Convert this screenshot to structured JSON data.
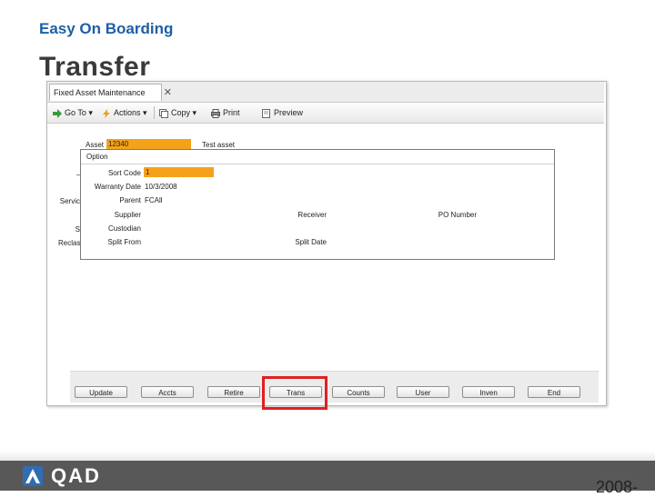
{
  "slide": {
    "subtitle": "Easy On Boarding",
    "title": "Transfer",
    "year": "2008-"
  },
  "window": {
    "tab_label": "Fixed Asset Maintenance",
    "tab_close": "✕"
  },
  "toolbar": {
    "goto": "Go To",
    "actions": "Actions",
    "copy": "Copy",
    "print": "Print",
    "preview": "Preview"
  },
  "form": {
    "asset_label": "Asset",
    "asset_value": "12340",
    "asset_desc": "Test asset",
    "left_labels": [
      "Servic",
      "S",
      "Reclas"
    ],
    "fields": {
      "sort_code_label": "Sort Code",
      "sort_code_value": "1",
      "warranty_label": "Warranty Date",
      "warranty_value": "10/3/2008",
      "parent_label": "Parent",
      "parent_value": "FCAll",
      "supplier_label": "Supplier",
      "receiver_label": "Receiver",
      "po_label": "PO Number",
      "custodian_label": "Custodian",
      "split_from_label": "Split From",
      "split_date_label": "Split Date"
    }
  },
  "dialog": {
    "title": "Option"
  },
  "buttons": [
    "Update",
    "Accts",
    "Retire",
    "Trans",
    "Counts",
    "User",
    "Inven",
    "End"
  ],
  "highlighted_button": "Trans",
  "brand": {
    "logo_text": "QAD"
  },
  "colors": {
    "accent_blue": "#1d5fa6",
    "field_orange": "#f5a21b",
    "highlight_red": "#e02020",
    "footer_gray": "#585858"
  }
}
